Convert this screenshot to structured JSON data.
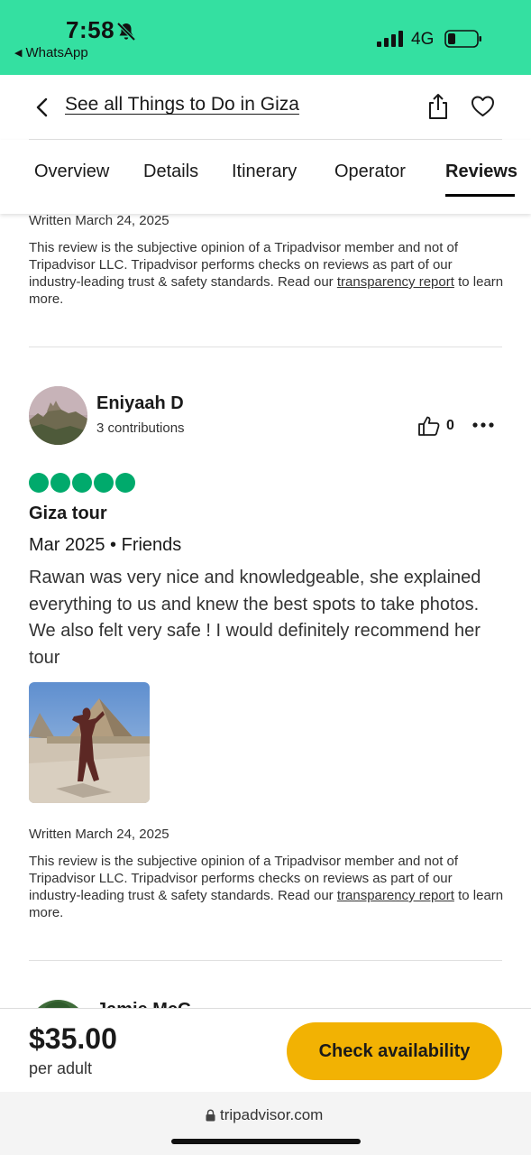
{
  "status_bar": {
    "time": "7:58",
    "back_app": "WhatsApp",
    "network": "4G"
  },
  "nav": {
    "back_label": "See all Things to Do in Giza"
  },
  "tabs": [
    {
      "label": "Overview",
      "active": false
    },
    {
      "label": "Details",
      "active": false
    },
    {
      "label": "Itinerary",
      "active": false
    },
    {
      "label": "Operator",
      "active": false
    },
    {
      "label": "Reviews",
      "active": true
    }
  ],
  "previous_review": {
    "written": "Written March 24, 2025",
    "disclaimer_before": "This review is the subjective opinion of a Tripadvisor member and not of Tripadvisor LLC. Tripadvisor performs checks on reviews as part of our industry-leading trust & safety standards. Read our ",
    "disclaimer_link": "transparency report",
    "disclaimer_after": " to learn more."
  },
  "review": {
    "reviewer_name": "Eniyaah D",
    "contributions": "3 contributions",
    "helpful_count": "0",
    "rating": 5,
    "title": "Giza tour",
    "meta": "Mar 2025 • Friends",
    "body": "Rawan was very nice and knowledgeable, she explained everything to us and knew the best spots to take photos. We also felt very safe ! I would definitely recommend her tour",
    "written": "Written March 24, 2025",
    "disclaimer_before": "This review is the subjective opinion of a Tripadvisor member and not of Tripadvisor LLC. Tripadvisor performs checks on reviews as part of our industry-leading trust & safety standards. Read our ",
    "disclaimer_link": "transparency report",
    "disclaimer_after": " to learn more."
  },
  "next_review": {
    "reviewer_name": "Jamie McG"
  },
  "booking": {
    "price": "$35.00",
    "unit": "per adult",
    "cta_label": "Check availability"
  },
  "browser": {
    "url": "tripadvisor.com"
  },
  "colors": {
    "status_bar": "#34e0a1",
    "rating_bubble": "#00aa6c",
    "cta": "#f2b203"
  }
}
